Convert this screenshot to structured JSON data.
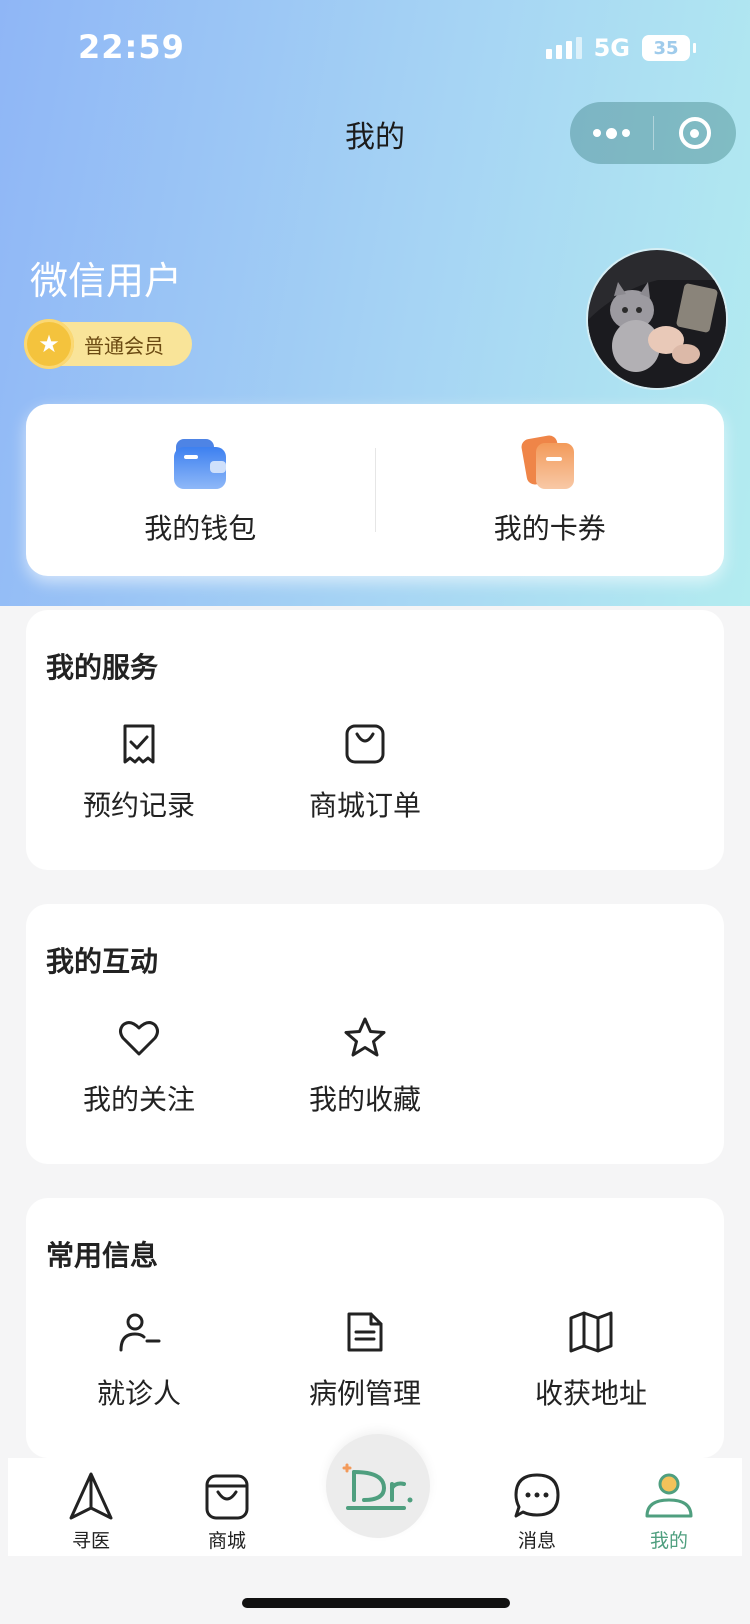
{
  "status_bar": {
    "time": "22:59",
    "network": "5G",
    "battery": "35"
  },
  "nav": {
    "title": "我的"
  },
  "profile": {
    "name": "微信用户",
    "member_level": "普通会员"
  },
  "wallet_card": [
    {
      "label": "我的钱包",
      "icon": "wallet-icon"
    },
    {
      "label": "我的卡券",
      "icon": "coupon-icon"
    }
  ],
  "sections": [
    {
      "title": "我的服务",
      "items": [
        {
          "label": "预约记录",
          "icon": "receipt-check-icon"
        },
        {
          "label": "商城订单",
          "icon": "shopping-bag-icon"
        }
      ]
    },
    {
      "title": "我的互动",
      "items": [
        {
          "label": "我的关注",
          "icon": "heart-icon"
        },
        {
          "label": "我的收藏",
          "icon": "star-icon"
        }
      ]
    },
    {
      "title": "常用信息",
      "items": [
        {
          "label": "就诊人",
          "icon": "user-minus-icon"
        },
        {
          "label": "病例管理",
          "icon": "document-icon"
        },
        {
          "label": "收获地址",
          "icon": "map-icon"
        }
      ]
    }
  ],
  "tabbar": [
    {
      "label": "寻医",
      "icon": "navigation-icon",
      "active": false
    },
    {
      "label": "商城",
      "icon": "shopping-bag-icon",
      "active": false
    },
    {
      "label": "",
      "icon": "dr-logo-icon",
      "active": false
    },
    {
      "label": "消息",
      "icon": "chat-bubble-icon",
      "active": false
    },
    {
      "label": "我的",
      "icon": "profile-icon",
      "active": true
    }
  ],
  "colors": {
    "accent_green": "#4f9f7f",
    "badge_yellow": "#f9e499",
    "wallet_blue": "#3d80f0",
    "coupon_orange": "#f39a5a"
  }
}
